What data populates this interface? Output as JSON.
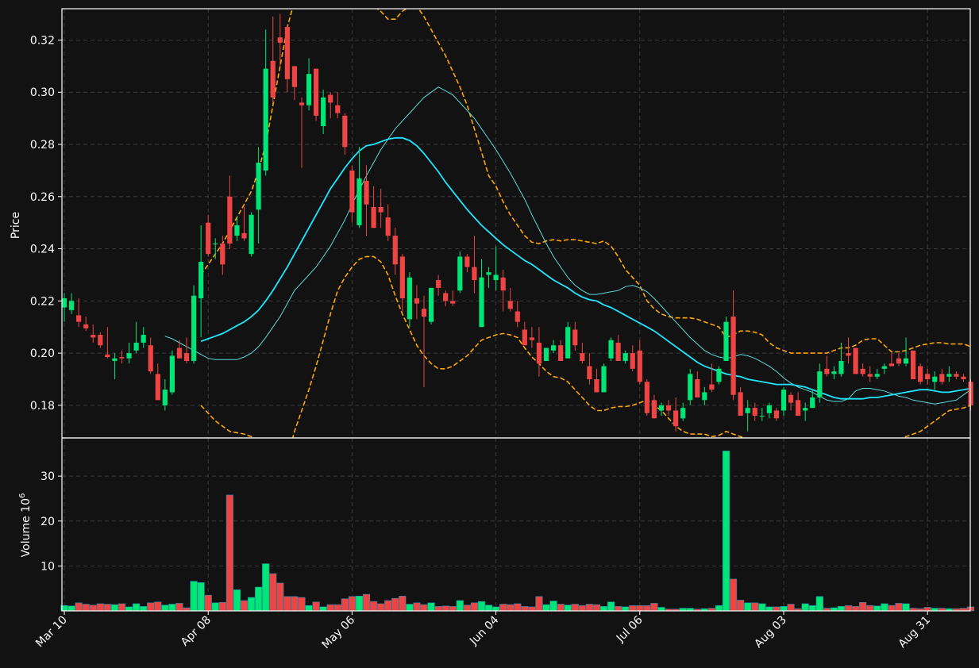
{
  "chart_data": {
    "type": "candlestick",
    "price_panel": {
      "ylabel": "Price",
      "ylim": [
        0.1675,
        0.332
      ],
      "yticks": [
        "0.18",
        "0.20",
        "0.22",
        "0.24",
        "0.26",
        "0.28",
        "0.30",
        "0.32"
      ],
      "grid": true
    },
    "volume_panel": {
      "ylabel": "Volume",
      "ylabel_exponent": "6",
      "ylim": [
        0,
        38.5
      ],
      "yticks": [
        "10",
        "20",
        "30"
      ],
      "grid": true
    },
    "xaxis": {
      "ticks": [
        {
          "label": "Mar 10",
          "index": 0
        },
        {
          "label": "Apr 08",
          "index": 20
        },
        {
          "label": "May 06",
          "index": 40
        },
        {
          "label": "Jun 04",
          "index": 60
        },
        {
          "label": "Jul 06",
          "index": 80
        },
        {
          "label": "Aug 03",
          "index": 100
        },
        {
          "label": "Aug 31",
          "index": 120
        }
      ]
    },
    "colors": {
      "up": "#00e676",
      "down": "#ef4444",
      "ma_fast": "#5ad8d8",
      "ma_slow": "#1ee6ff",
      "bands": "#ffa500",
      "background": "#121212",
      "grid": "#3a3a3a"
    },
    "candles": [
      [
        0.2175,
        0.223,
        0.212,
        0.221
      ],
      [
        0.2165,
        0.223,
        0.215,
        0.22
      ],
      [
        0.2145,
        0.221,
        0.21,
        0.212
      ],
      [
        0.211,
        0.214,
        0.2085,
        0.2095
      ],
      [
        0.207,
        0.211,
        0.204,
        0.206
      ],
      [
        0.207,
        0.208,
        0.202,
        0.203
      ],
      [
        0.1995,
        0.21,
        0.198,
        0.1985
      ],
      [
        0.197,
        0.2,
        0.19,
        0.198
      ],
      [
        0.1985,
        0.201,
        0.196,
        0.198
      ],
      [
        0.198,
        0.204,
        0.196,
        0.2
      ],
      [
        0.201,
        0.212,
        0.2,
        0.204
      ],
      [
        0.204,
        0.21,
        0.202,
        0.207
      ],
      [
        0.203,
        0.206,
        0.192,
        0.193
      ],
      [
        0.192,
        0.196,
        0.182,
        0.182
      ],
      [
        0.18,
        0.19,
        0.178,
        0.186
      ],
      [
        0.185,
        0.201,
        0.184,
        0.199
      ],
      [
        0.202,
        0.205,
        0.198,
        0.198
      ],
      [
        0.2,
        0.206,
        0.196,
        0.197
      ],
      [
        0.197,
        0.226,
        0.196,
        0.222
      ],
      [
        0.221,
        0.249,
        0.206,
        0.235
      ],
      [
        0.25,
        0.253,
        0.237,
        0.238
      ],
      [
        0.242,
        0.244,
        0.236,
        0.242
      ],
      [
        0.242,
        0.245,
        0.23,
        0.234
      ],
      [
        0.26,
        0.268,
        0.24,
        0.242
      ],
      [
        0.245,
        0.252,
        0.243,
        0.249
      ],
      [
        0.246,
        0.256,
        0.243,
        0.244
      ],
      [
        0.238,
        0.254,
        0.237,
        0.253
      ],
      [
        0.255,
        0.279,
        0.242,
        0.273
      ],
      [
        0.27,
        0.324,
        0.268,
        0.309
      ],
      [
        0.312,
        0.329,
        0.296,
        0.298
      ],
      [
        0.321,
        0.33,
        0.31,
        0.319
      ],
      [
        0.325,
        0.326,
        0.3,
        0.305
      ],
      [
        0.31,
        0.31,
        0.297,
        0.302
      ],
      [
        0.296,
        0.298,
        0.271,
        0.295
      ],
      [
        0.295,
        0.313,
        0.293,
        0.307
      ],
      [
        0.309,
        0.309,
        0.289,
        0.291
      ],
      [
        0.287,
        0.301,
        0.284,
        0.298
      ],
      [
        0.299,
        0.3,
        0.29,
        0.296
      ],
      [
        0.295,
        0.3,
        0.29,
        0.292
      ],
      [
        0.291,
        0.292,
        0.276,
        0.279
      ],
      [
        0.27,
        0.272,
        0.25,
        0.254
      ],
      [
        0.249,
        0.279,
        0.248,
        0.267
      ],
      [
        0.266,
        0.272,
        0.245,
        0.257
      ],
      [
        0.256,
        0.264,
        0.248,
        0.248
      ],
      [
        0.256,
        0.263,
        0.248,
        0.254
      ],
      [
        0.252,
        0.257,
        0.243,
        0.245
      ],
      [
        0.245,
        0.248,
        0.23,
        0.234
      ],
      [
        0.237,
        0.238,
        0.216,
        0.221
      ],
      [
        0.213,
        0.231,
        0.21,
        0.229
      ],
      [
        0.221,
        0.226,
        0.213,
        0.219
      ],
      [
        0.217,
        0.222,
        0.187,
        0.214
      ],
      [
        0.212,
        0.225,
        0.211,
        0.225
      ],
      [
        0.228,
        0.23,
        0.222,
        0.225
      ],
      [
        0.223,
        0.224,
        0.218,
        0.22
      ],
      [
        0.22,
        0.224,
        0.218,
        0.219
      ],
      [
        0.224,
        0.239,
        0.223,
        0.237
      ],
      [
        0.237,
        0.238,
        0.231,
        0.233
      ],
      [
        0.233,
        0.245,
        0.223,
        0.228
      ],
      [
        0.21,
        0.236,
        0.21,
        0.229
      ],
      [
        0.23,
        0.233,
        0.225,
        0.231
      ],
      [
        0.228,
        0.241,
        0.224,
        0.23
      ],
      [
        0.229,
        0.232,
        0.216,
        0.224
      ],
      [
        0.22,
        0.225,
        0.216,
        0.217
      ],
      [
        0.216,
        0.22,
        0.21,
        0.212
      ],
      [
        0.209,
        0.212,
        0.203,
        0.203
      ],
      [
        0.206,
        0.21,
        0.202,
        0.205
      ],
      [
        0.204,
        0.21,
        0.191,
        0.196
      ],
      [
        0.197,
        0.202,
        0.197,
        0.202
      ],
      [
        0.201,
        0.205,
        0.2,
        0.203
      ],
      [
        0.203,
        0.205,
        0.197,
        0.197
      ],
      [
        0.198,
        0.212,
        0.198,
        0.21
      ],
      [
        0.209,
        0.212,
        0.201,
        0.203
      ],
      [
        0.2,
        0.204,
        0.196,
        0.197
      ],
      [
        0.195,
        0.2,
        0.188,
        0.19
      ],
      [
        0.19,
        0.194,
        0.185,
        0.185
      ],
      [
        0.185,
        0.196,
        0.185,
        0.195
      ],
      [
        0.198,
        0.206,
        0.197,
        0.205
      ],
      [
        0.204,
        0.207,
        0.197,
        0.197
      ],
      [
        0.197,
        0.201,
        0.196,
        0.2
      ],
      [
        0.2,
        0.203,
        0.193,
        0.194
      ],
      [
        0.201,
        0.205,
        0.188,
        0.189
      ],
      [
        0.189,
        0.19,
        0.176,
        0.177
      ],
      [
        0.182,
        0.184,
        0.175,
        0.175
      ],
      [
        0.178,
        0.181,
        0.176,
        0.18
      ],
      [
        0.18,
        0.182,
        0.176,
        0.178
      ],
      [
        0.178,
        0.183,
        0.17,
        0.172
      ],
      [
        0.175,
        0.181,
        0.174,
        0.179
      ],
      [
        0.182,
        0.194,
        0.18,
        0.192
      ],
      [
        0.19,
        0.193,
        0.183,
        0.183
      ],
      [
        0.182,
        0.187,
        0.18,
        0.185
      ],
      [
        0.188,
        0.196,
        0.185,
        0.186
      ],
      [
        0.189,
        0.195,
        0.188,
        0.194
      ],
      [
        0.197,
        0.214,
        0.197,
        0.212
      ],
      [
        0.214,
        0.224,
        0.182,
        0.184
      ],
      [
        0.185,
        0.187,
        0.176,
        0.176
      ],
      [
        0.177,
        0.182,
        0.17,
        0.179
      ],
      [
        0.179,
        0.181,
        0.174,
        0.176
      ],
      [
        0.176,
        0.179,
        0.174,
        0.176
      ],
      [
        0.177,
        0.181,
        0.175,
        0.18
      ],
      [
        0.178,
        0.179,
        0.174,
        0.175
      ],
      [
        0.178,
        0.187,
        0.176,
        0.186
      ],
      [
        0.184,
        0.185,
        0.178,
        0.181
      ],
      [
        0.182,
        0.185,
        0.176,
        0.176
      ],
      [
        0.178,
        0.181,
        0.174,
        0.179
      ],
      [
        0.179,
        0.186,
        0.179,
        0.183
      ],
      [
        0.183,
        0.196,
        0.181,
        0.193
      ],
      [
        0.194,
        0.199,
        0.191,
        0.192
      ],
      [
        0.192,
        0.195,
        0.19,
        0.193
      ],
      [
        0.192,
        0.204,
        0.191,
        0.197
      ],
      [
        0.2,
        0.206,
        0.196,
        0.199
      ],
      [
        0.202,
        0.202,
        0.192,
        0.192
      ],
      [
        0.194,
        0.196,
        0.191,
        0.192
      ],
      [
        0.192,
        0.195,
        0.189,
        0.191
      ],
      [
        0.191,
        0.194,
        0.19,
        0.192
      ],
      [
        0.194,
        0.196,
        0.192,
        0.195
      ],
      [
        0.196,
        0.2,
        0.195,
        0.195
      ],
      [
        0.198,
        0.2,
        0.195,
        0.196
      ],
      [
        0.196,
        0.206,
        0.195,
        0.198
      ],
      [
        0.201,
        0.201,
        0.19,
        0.19
      ],
      [
        0.195,
        0.196,
        0.188,
        0.189
      ],
      [
        0.192,
        0.194,
        0.188,
        0.19
      ],
      [
        0.189,
        0.193,
        0.186,
        0.191
      ],
      [
        0.192,
        0.194,
        0.188,
        0.189
      ],
      [
        0.191,
        0.195,
        0.189,
        0.192
      ],
      [
        0.192,
        0.193,
        0.19,
        0.191
      ],
      [
        0.191,
        0.192,
        0.189,
        0.19
      ],
      [
        0.189,
        0.19,
        0.178,
        0.18
      ]
    ],
    "volume": [
      1.2,
      1.1,
      1.8,
      1.5,
      1.3,
      1.6,
      1.5,
      1.4,
      1.6,
      0.9,
      1.6,
      1.0,
      1.8,
      2.0,
      1.3,
      1.5,
      1.7,
      0.7,
      6.6,
      6.3,
      3.5,
      1.8,
      1.9,
      25.8,
      4.7,
      2.3,
      3.0,
      5.3,
      10.5,
      8.3,
      6.2,
      3.2,
      3.2,
      3.0,
      1.2,
      2.0,
      0.9,
      1.4,
      1.4,
      2.7,
      3.2,
      3.3,
      3.7,
      2.1,
      1.6,
      2.3,
      2.8,
      3.3,
      1.5,
      1.8,
      1.4,
      1.8,
      1.0,
      1.1,
      1.0,
      2.3,
      1.3,
      1.8,
      2.1,
      1.3,
      0.9,
      1.5,
      1.4,
      1.6,
      1.0,
      0.9,
      3.2,
      1.4,
      2.2,
      1.5,
      1.3,
      1.5,
      1.2,
      1.5,
      1.4,
      1.0,
      2.0,
      1.0,
      0.9,
      1.2,
      1.2,
      1.2,
      1.7,
      0.8,
      0.4,
      0.4,
      0.6,
      0.6,
      0.4,
      0.5,
      0.6,
      1.2,
      35.6,
      7.1,
      2.4,
      1.8,
      1.8,
      1.6,
      0.9,
      0.9,
      1.0,
      1.5,
      0.5,
      1.6,
      1.2,
      3.2,
      0.6,
      0.7,
      1.0,
      1.2,
      1.0,
      1.9,
      1.2,
      1.1,
      1.6,
      1.2,
      1.7,
      1.6,
      0.6,
      0.5,
      0.8,
      0.6,
      0.6,
      0.5,
      0.5,
      0.6,
      0.9
    ],
    "ma_fast": {
      "start": 14,
      "values": [
        0.2065,
        0.2055,
        0.204,
        0.2025,
        0.201,
        0.1995,
        0.198,
        0.1975,
        0.1975,
        0.1975,
        0.1975,
        0.1985,
        0.2,
        0.2025,
        0.206,
        0.21,
        0.214,
        0.219,
        0.224,
        0.227,
        0.23,
        0.233,
        0.237,
        0.241,
        0.246,
        0.251,
        0.257,
        0.2625,
        0.268,
        0.273,
        0.278,
        0.282,
        0.286,
        0.289,
        0.292,
        0.295,
        0.298,
        0.3,
        0.302,
        0.3005,
        0.299,
        0.296,
        0.293,
        0.29,
        0.286,
        0.282,
        0.278,
        0.2735,
        0.269,
        0.264,
        0.259,
        0.253,
        0.2475,
        0.242,
        0.237,
        0.233,
        0.229,
        0.226,
        0.224,
        0.2225,
        0.2225,
        0.223,
        0.2235,
        0.224,
        0.2255,
        0.226,
        0.225,
        0.2235,
        0.221,
        0.218,
        0.215,
        0.212,
        0.209,
        0.206,
        0.2035,
        0.201,
        0.1995,
        0.1985,
        0.198,
        0.1985,
        0.1995,
        0.199,
        0.198,
        0.1965,
        0.195,
        0.193,
        0.1905,
        0.1885,
        0.187,
        0.186,
        0.185,
        0.1835,
        0.182,
        0.1815,
        0.1815,
        0.1825,
        0.1855,
        0.1865,
        0.1865,
        0.186,
        0.1855,
        0.1845,
        0.1835,
        0.183,
        0.182,
        0.1815,
        0.181,
        0.1805,
        0.181,
        0.1815,
        0.182,
        0.184,
        0.186,
        0.1875,
        0.188,
        0.1885,
        0.1895,
        0.191,
        0.1925,
        0.1935,
        0.1945,
        0.1955,
        0.196,
        0.1955,
        0.195,
        0.194,
        0.1935,
        0.1935,
        0.1935,
        0.193,
        0.193,
        0.192
      ]
    },
    "ma_slow": {
      "start": 19,
      "values": [
        0.2045,
        0.2055,
        0.2065,
        0.2075,
        0.209,
        0.2105,
        0.212,
        0.214,
        0.2165,
        0.22,
        0.224,
        0.2285,
        0.233,
        0.238,
        0.243,
        0.248,
        0.253,
        0.258,
        0.263,
        0.267,
        0.271,
        0.2745,
        0.2775,
        0.2795,
        0.28,
        0.281,
        0.282,
        0.2825,
        0.2825,
        0.2815,
        0.2795,
        0.2765,
        0.273,
        0.2695,
        0.2655,
        0.262,
        0.2585,
        0.255,
        0.252,
        0.249,
        0.2465,
        0.244,
        0.2415,
        0.2395,
        0.2375,
        0.2355,
        0.234,
        0.232,
        0.23,
        0.228,
        0.2265,
        0.225,
        0.223,
        0.2215,
        0.2205,
        0.22,
        0.2185,
        0.2175,
        0.216,
        0.2145,
        0.213,
        0.2115,
        0.21,
        0.2085,
        0.2065,
        0.2045,
        0.2025,
        0.2005,
        0.1985,
        0.1965,
        0.195,
        0.194,
        0.193,
        0.192,
        0.1915,
        0.191,
        0.19,
        0.1895,
        0.189,
        0.1885,
        0.188,
        0.188,
        0.188,
        0.1875,
        0.187,
        0.186,
        0.185,
        0.184,
        0.183,
        0.1825,
        0.1825,
        0.1825,
        0.1825,
        0.183,
        0.183,
        0.1835,
        0.184,
        0.1845,
        0.185,
        0.1855,
        0.186,
        0.186,
        0.1855,
        0.185,
        0.185,
        0.1855,
        0.186,
        0.1865,
        0.187,
        0.1875,
        0.188,
        0.1885,
        0.189,
        0.19,
        0.191,
        0.1915,
        0.192,
        0.192,
        0.1925,
        0.193
      ]
    },
    "band_upper": {
      "start": 19,
      "values": [
        0.23,
        0.234,
        0.238,
        0.242,
        0.247,
        0.252,
        0.257,
        0.262,
        0.27,
        0.28,
        0.295,
        0.31,
        0.325,
        0.335,
        0.34,
        0.344,
        0.347,
        0.348,
        0.349,
        0.3495,
        0.349,
        0.347,
        0.344,
        0.338,
        0.333,
        0.331,
        0.328,
        0.328,
        0.331,
        0.333,
        0.333,
        0.329,
        0.324,
        0.319,
        0.314,
        0.308,
        0.302,
        0.295,
        0.286,
        0.277,
        0.268,
        0.264,
        0.258,
        0.253,
        0.249,
        0.245,
        0.2425,
        0.242,
        0.243,
        0.2435,
        0.243,
        0.2435,
        0.2435,
        0.243,
        0.2425,
        0.242,
        0.243,
        0.241,
        0.237,
        0.232,
        0.229,
        0.226,
        0.22,
        0.217,
        0.215,
        0.214,
        0.2135,
        0.2135,
        0.2135,
        0.213,
        0.212,
        0.211,
        0.21,
        0.206,
        0.207,
        0.2085,
        0.2085,
        0.208,
        0.207,
        0.204,
        0.202,
        0.201,
        0.2,
        0.2,
        0.2,
        0.2,
        0.2,
        0.2,
        0.201,
        0.202,
        0.202,
        0.203,
        0.205,
        0.2055,
        0.2055,
        0.203,
        0.2005,
        0.2005,
        0.201,
        0.202,
        0.203,
        0.2035,
        0.204,
        0.204,
        0.2035,
        0.2035,
        0.2035,
        0.2025,
        0.202,
        0.2005,
        0.1995,
        0.2,
        0.201
      ]
    },
    "band_lower": {
      "start": 19,
      "values": [
        0.18,
        0.177,
        0.174,
        0.172,
        0.17,
        0.1695,
        0.169,
        0.168,
        0.166,
        0.162,
        0.158,
        0.156,
        0.16,
        0.17,
        0.178,
        0.186,
        0.195,
        0.205,
        0.215,
        0.224,
        0.229,
        0.233,
        0.236,
        0.237,
        0.237,
        0.235,
        0.23,
        0.222,
        0.215,
        0.209,
        0.203,
        0.199,
        0.196,
        0.194,
        0.194,
        0.195,
        0.197,
        0.199,
        0.202,
        0.205,
        0.206,
        0.207,
        0.2075,
        0.207,
        0.206,
        0.202,
        0.1985,
        0.196,
        0.193,
        0.191,
        0.1905,
        0.189,
        0.186,
        0.183,
        0.18,
        0.178,
        0.178,
        0.179,
        0.1795,
        0.1795,
        0.18,
        0.181,
        0.182,
        0.18,
        0.178,
        0.175,
        0.172,
        0.17,
        0.169,
        0.169,
        0.169,
        0.168,
        0.1685,
        0.17,
        0.169,
        0.168,
        0.167,
        0.166,
        0.165,
        0.164,
        0.164,
        0.164,
        0.164,
        0.164,
        0.164,
        0.164,
        0.164,
        0.164,
        0.164,
        0.164,
        0.164,
        0.164,
        0.164,
        0.164,
        0.164,
        0.164,
        0.165,
        0.167,
        0.168,
        0.169,
        0.17,
        0.172,
        0.174,
        0.176,
        0.178,
        0.1785,
        0.179,
        0.18,
        0.182,
        0.184,
        0.186,
        0.1855,
        0.183
      ]
    }
  }
}
